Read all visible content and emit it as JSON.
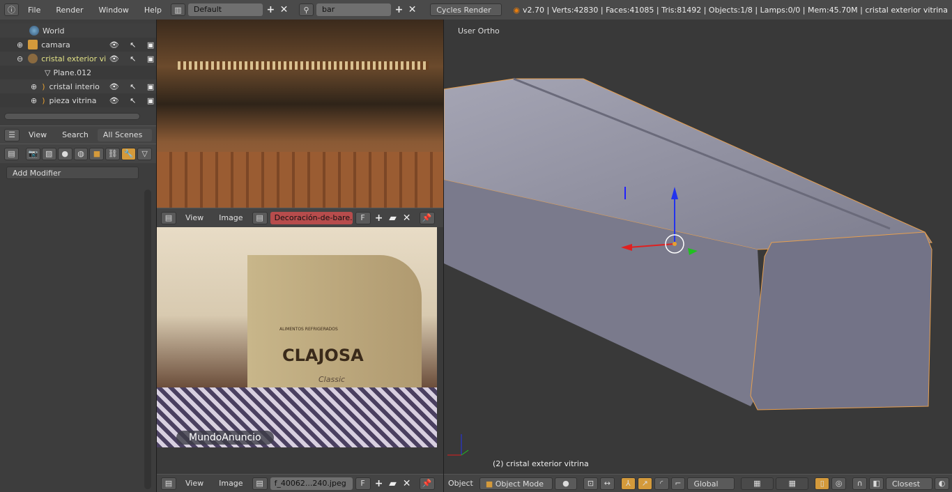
{
  "topbar": {
    "menus": [
      "File",
      "Render",
      "Window",
      "Help"
    ],
    "screen_layout": "Default",
    "scene": "bar",
    "render_engine": "Cycles Render",
    "stats": "v2.70 | Verts:42830 | Faces:41085 | Tris:81492 | Objects:1/8 | Lamps:0/0 | Mem:45.70M | cristal exterior vitrina"
  },
  "outliner": {
    "items": [
      {
        "label": "World",
        "icon": "world-icon"
      },
      {
        "label": "camara",
        "icon": "camera-icon"
      },
      {
        "label": "cristal exterior vi",
        "icon": "mesh-icon",
        "selected": true
      },
      {
        "label": "Plane.012",
        "icon": "mesh-data-icon"
      },
      {
        "label": "cristal interio",
        "icon": "curve-icon"
      },
      {
        "label": "pieza vitrina",
        "icon": "curve-icon"
      }
    ],
    "header": {
      "view": "View",
      "search": "Search",
      "filter": "All Scenes"
    }
  },
  "properties": {
    "add_modifier": "Add Modifier",
    "active_tab": "modifiers"
  },
  "image_editor_top": {
    "view": "View",
    "image": "Image",
    "image_name": "Decoración-de-bare...",
    "fake_user": "F"
  },
  "image_editor_bottom": {
    "view": "View",
    "image": "Image",
    "image_name": "f_40062...240.jpeg",
    "fake_user": "F",
    "photo_logo": "MundoAnuncio",
    "photo_brand": "CLAJOSA",
    "photo_sub": "ALIMENTOS REFRIGERADOS",
    "photo_model": "Classic"
  },
  "viewport": {
    "view_label": "User Ortho",
    "object_label": "(2) cristal exterior vitrina",
    "menu": "Object",
    "mode": "Object Mode",
    "orientation": "Global",
    "snap": "Closest"
  },
  "colors": {
    "selected_text": "#e3e386",
    "accent": "#d49a3b",
    "viewport_bg": "#393939"
  }
}
